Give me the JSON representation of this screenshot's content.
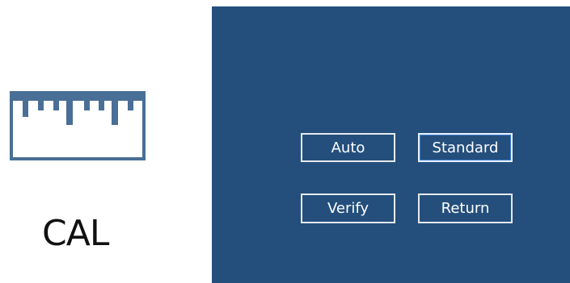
{
  "left": {
    "icon": "ruler-icon",
    "label": "CAL"
  },
  "panel": {
    "background": "#244f7c",
    "buttons": [
      {
        "label": "Auto"
      },
      {
        "label": "Standard",
        "focused": true
      },
      {
        "label": "Verify"
      },
      {
        "label": "Return"
      }
    ]
  }
}
